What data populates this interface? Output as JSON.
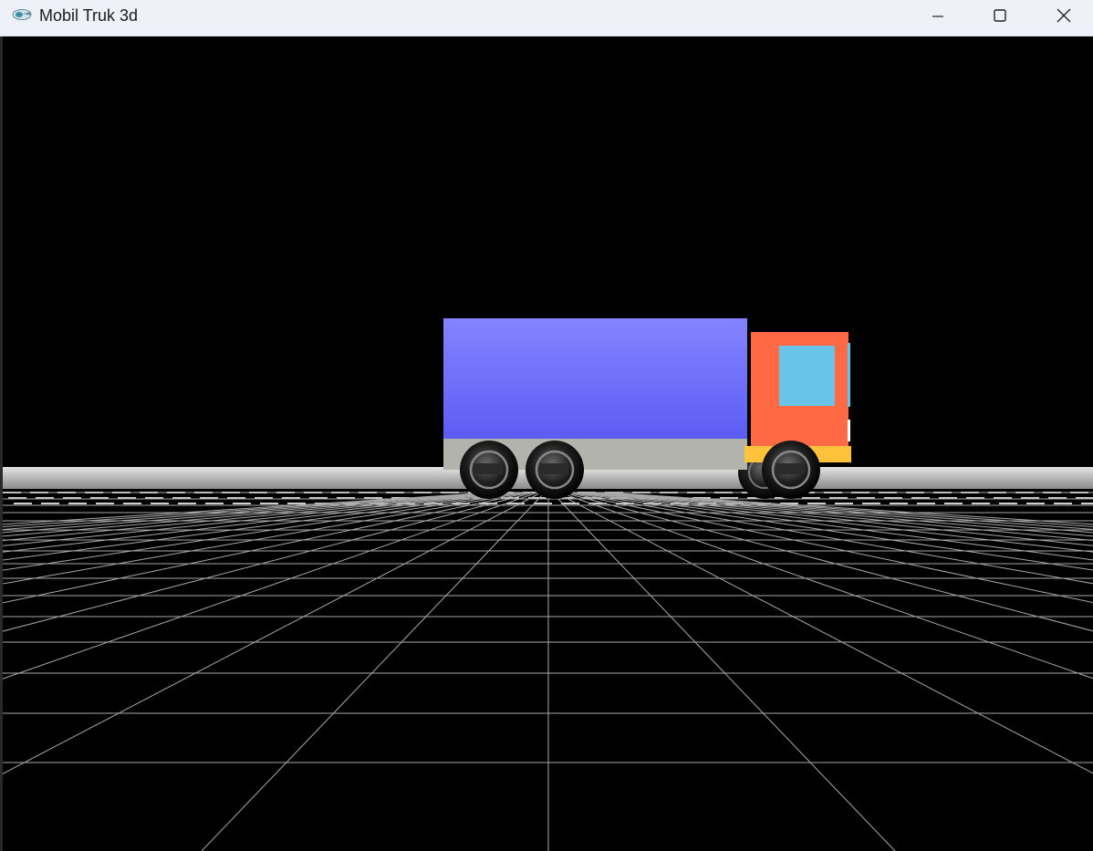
{
  "window": {
    "title": "Mobil Truk 3d",
    "app_icon": "opengl-glut-icon",
    "controls": {
      "minimize_icon": "minimize-icon",
      "maximize_icon": "maximize-icon",
      "close_icon": "close-icon"
    }
  },
  "scene": {
    "background_color": "#000000",
    "floor_color": "#b5b5b5",
    "grid_color": "#a8a8a8",
    "truck": {
      "cargo_box_color": "#6b6bff",
      "chassis_color": "#b3b3ad",
      "cab_color": "#ff6a45",
      "window_color": "#6ac3e8",
      "bumper_color": "#ffc23a",
      "wheel_color": "#1a1a1a"
    }
  }
}
